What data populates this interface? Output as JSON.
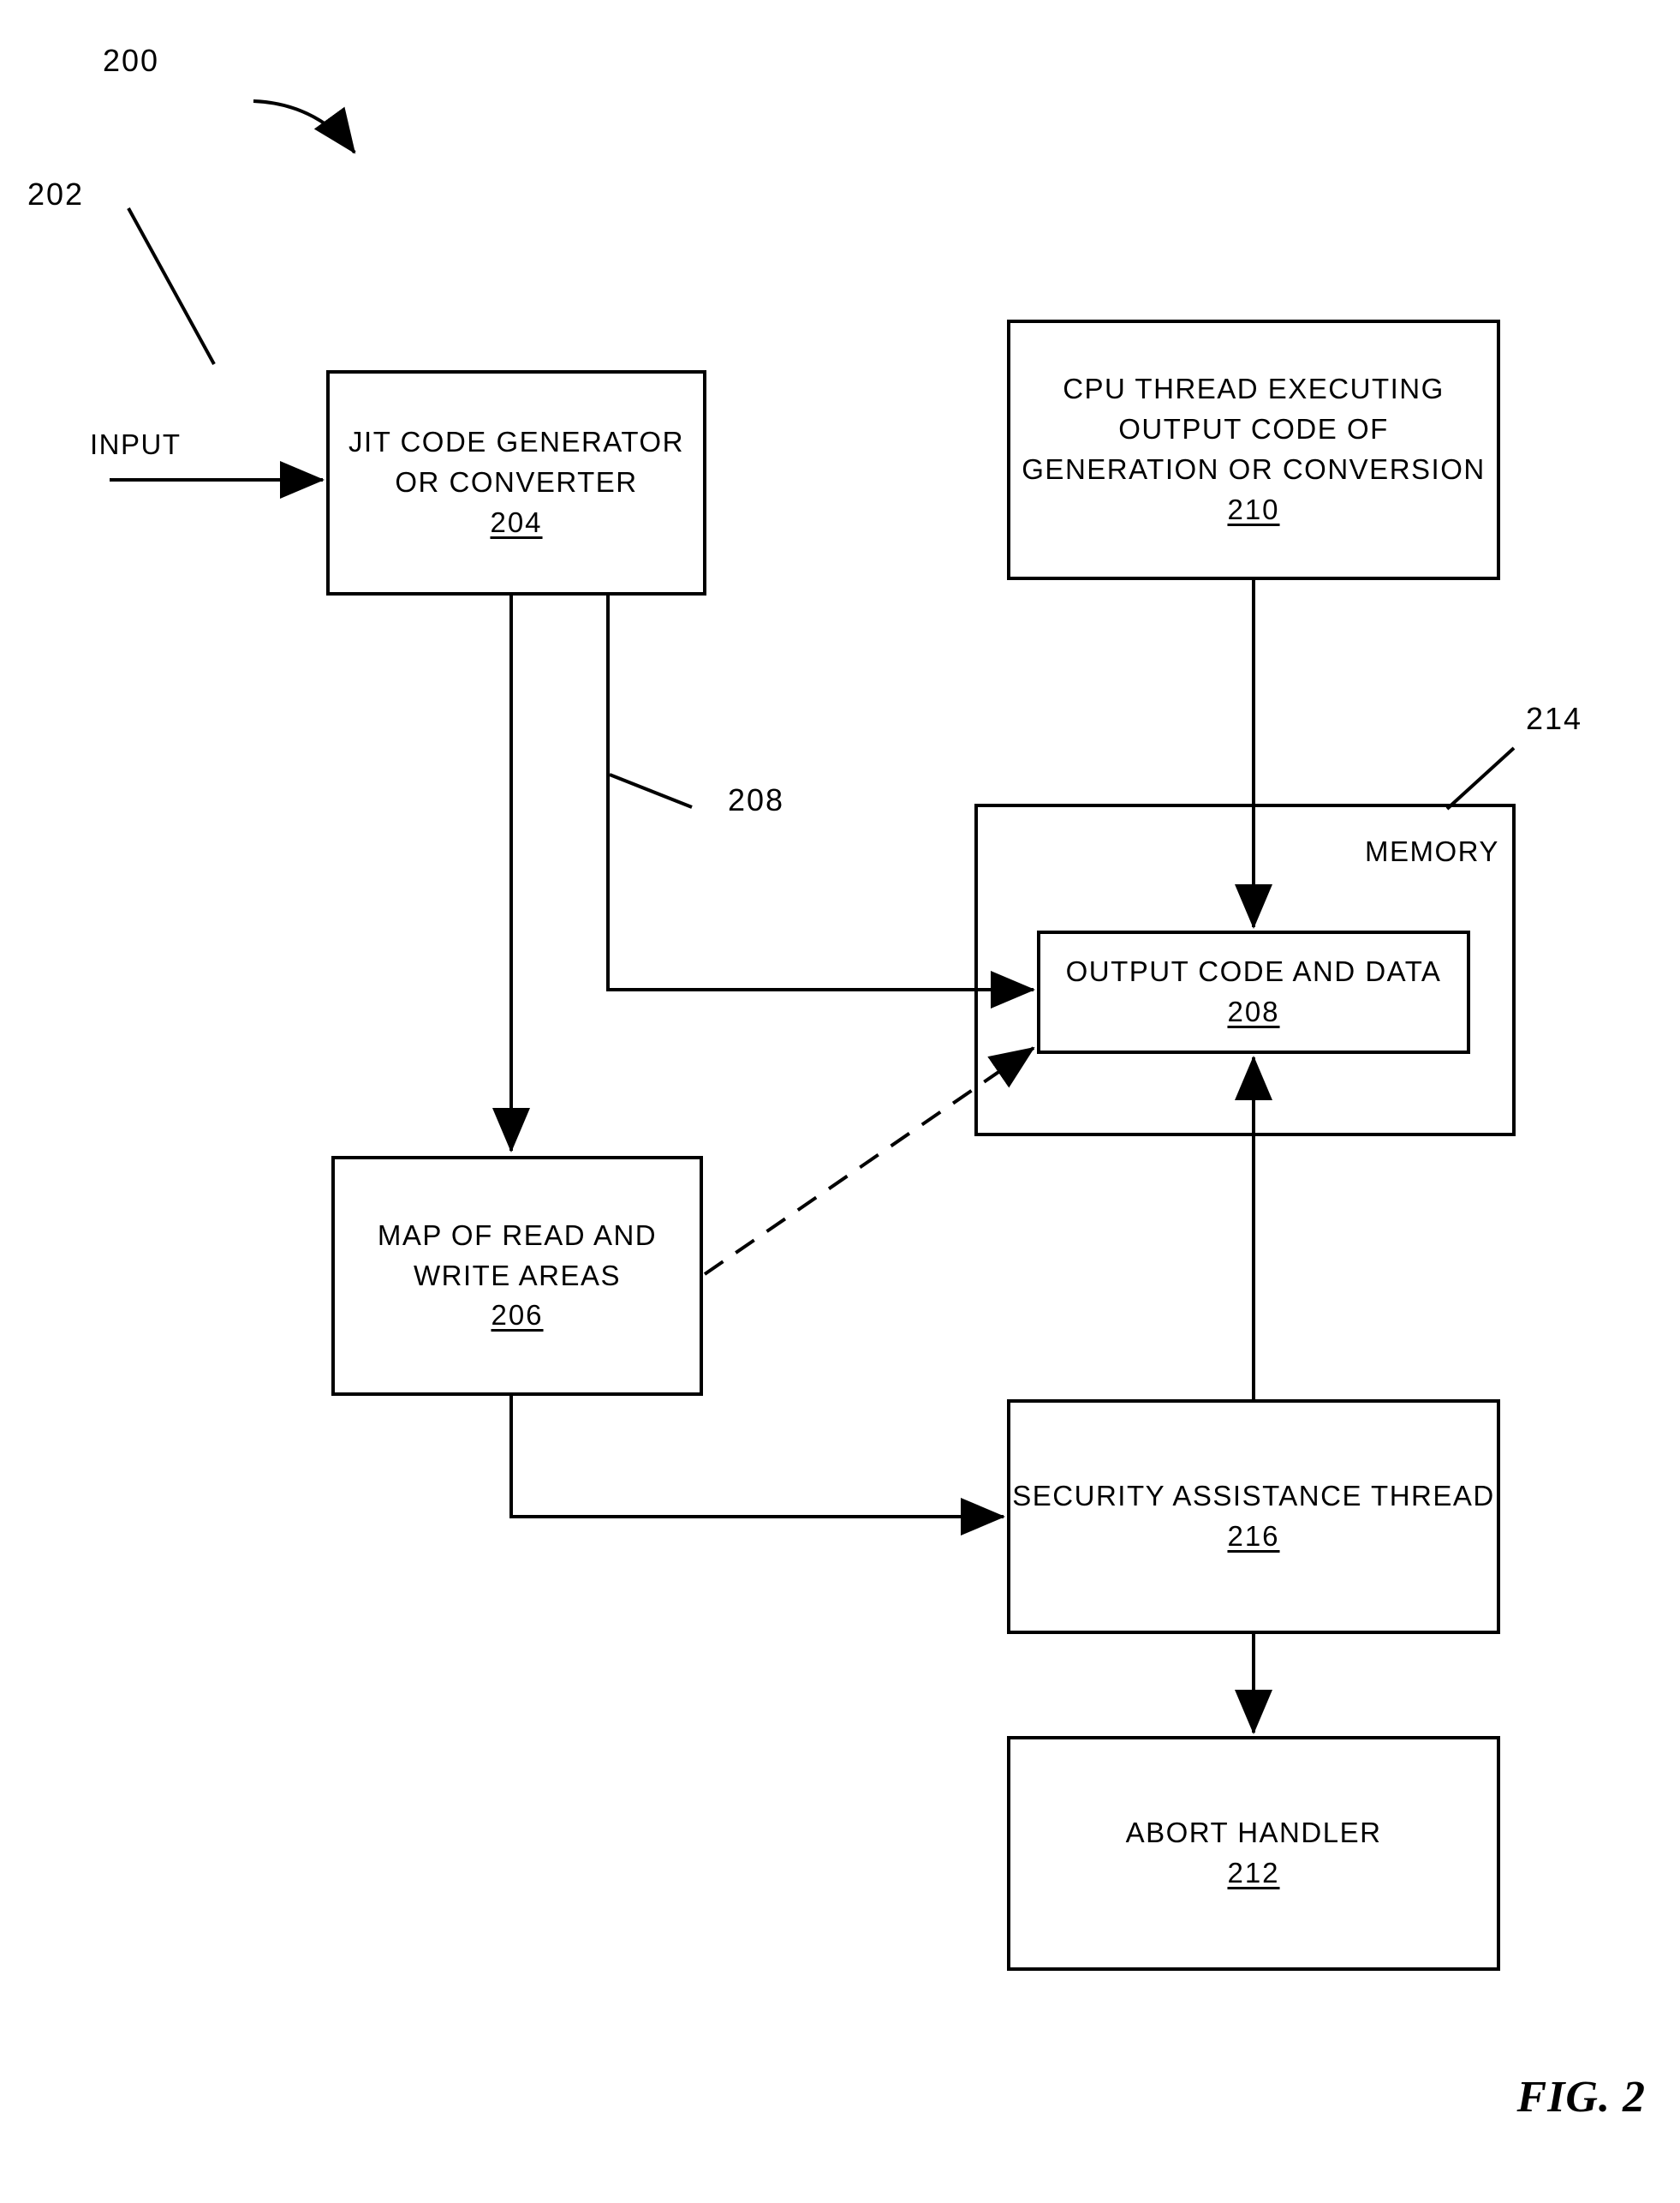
{
  "figure": {
    "caption": "FIG. 2",
    "diagram_ref": "200"
  },
  "callouts": {
    "input_ref": "202",
    "link_208_ref": "208",
    "memory_ref": "214"
  },
  "labels": {
    "input": "INPUT",
    "memory": "MEMORY"
  },
  "nodes": {
    "jit": {
      "line1": "JIT CODE GENERATOR",
      "line2": "OR CONVERTER",
      "ref": "204"
    },
    "map": {
      "line1": "MAP OF READ AND",
      "line2": "WRITE AREAS",
      "ref": "206"
    },
    "cpu_thread": {
      "line1": "CPU THREAD EXECUTING",
      "line2": "OUTPUT CODE OF",
      "line3": "GENERATION OR CONVERSION",
      "ref": "210"
    },
    "output_code": {
      "line1": "OUTPUT CODE AND DATA",
      "ref": "208"
    },
    "security_thread": {
      "line1": "SECURITY ASSISTANCE THREAD",
      "ref": "216"
    },
    "abort_handler": {
      "line1": "ABORT HANDLER",
      "ref": "212"
    }
  },
  "colors": {
    "stroke": "#000000",
    "background": "#ffffff"
  }
}
